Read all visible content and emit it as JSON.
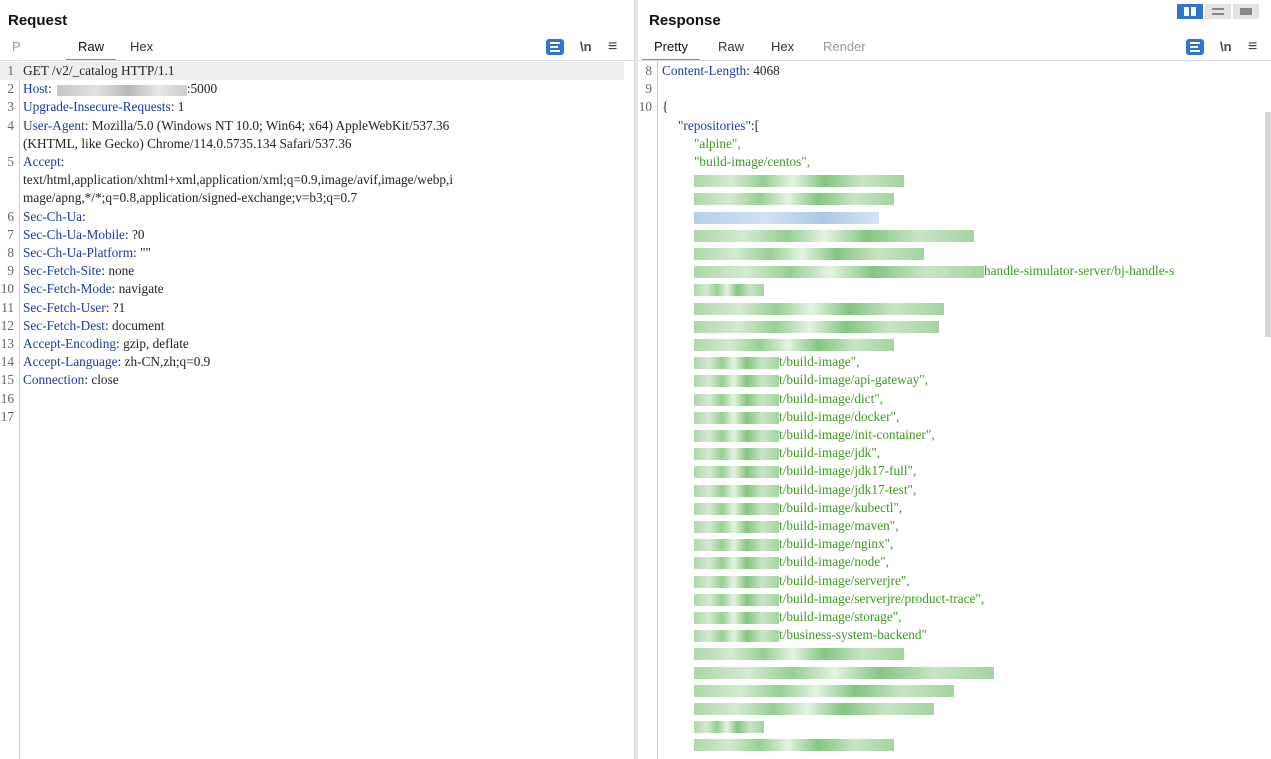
{
  "request": {
    "title": "Request",
    "tabs": [
      {
        "label": "P",
        "state": "dim"
      },
      {
        "label": "Raw",
        "state": "active"
      },
      {
        "label": "Hex",
        "state": "normal"
      }
    ],
    "newline_label": "\\n",
    "menu_label": "≡",
    "lines": [
      {
        "n": "1",
        "text": "GET /v2/_catalog HTTP/1.1"
      },
      {
        "n": "2",
        "key": "Host",
        "value": ":5000"
      },
      {
        "n": "3",
        "key": "Upgrade-Insecure-Requests",
        "value": " 1"
      },
      {
        "n": "4",
        "key": "User-Agent",
        "value": " Mozilla/5.0 (Windows NT 10.0; Win64; x64) AppleWebKit/537.36"
      },
      {
        "n": "",
        "text": "(KHTML, like Gecko) Chrome/114.0.5735.134 Safari/537.36"
      },
      {
        "n": "5",
        "key": "Accept",
        "value": ""
      },
      {
        "n": "",
        "text": "text/html,application/xhtml+xml,application/xml;q=0.9,image/avif,image/webp,i"
      },
      {
        "n": "",
        "text": "mage/apng,*/*;q=0.8,application/signed-exchange;v=b3;q=0.7"
      },
      {
        "n": "6",
        "key": "Sec-Ch-Ua",
        "value": ""
      },
      {
        "n": "7",
        "key": "Sec-Ch-Ua-Mobile",
        "value": " ?0"
      },
      {
        "n": "8",
        "key": "Sec-Ch-Ua-Platform",
        "value": " \"\""
      },
      {
        "n": "9",
        "key": "Sec-Fetch-Site",
        "value": " none"
      },
      {
        "n": "10",
        "key": "Sec-Fetch-Mode",
        "value": " navigate"
      },
      {
        "n": "11",
        "key": "Sec-Fetch-User",
        "value": " ?1"
      },
      {
        "n": "12",
        "key": "Sec-Fetch-Dest",
        "value": " document"
      },
      {
        "n": "13",
        "key": "Accept-Encoding",
        "value": " gzip, deflate"
      },
      {
        "n": "14",
        "key": "Accept-Language",
        "value": " zh-CN,zh;q=0.9"
      },
      {
        "n": "15",
        "key": "Connection",
        "value": " close"
      },
      {
        "n": "16",
        "text": ""
      },
      {
        "n": "17",
        "text": ""
      }
    ]
  },
  "response": {
    "title": "Response",
    "tabs": [
      {
        "label": "Pretty",
        "state": "active"
      },
      {
        "label": "Raw",
        "state": "normal"
      },
      {
        "label": "Hex",
        "state": "normal"
      },
      {
        "label": "Render",
        "state": "dim"
      }
    ],
    "newline_label": "\\n",
    "menu_label": "≡",
    "lines": [
      {
        "n": "8",
        "key": "Content-Length",
        "value": " 4068"
      },
      {
        "n": "9",
        "text": ""
      },
      {
        "n": "10",
        "text": "{"
      },
      {
        "n": "",
        "jkey": "\"repositories\"",
        "tail": ":["
      },
      {
        "n": "",
        "jstr": "\"alpine\","
      },
      {
        "n": "",
        "jstr": "\"build-image/centos\","
      },
      {
        "n": "",
        "blur": 1
      },
      {
        "n": "",
        "blur": 1
      },
      {
        "n": "",
        "blur": 1,
        "sel": true
      },
      {
        "n": "",
        "blur": 1
      },
      {
        "n": "",
        "blur": 1
      },
      {
        "n": "",
        "jstr": "handle-simulator-server/bj-handle-s",
        "pre": 1
      },
      {
        "n": "",
        "blur": 1,
        "short": true
      },
      {
        "n": "",
        "blur": 1
      },
      {
        "n": "",
        "blur": 1
      },
      {
        "n": "",
        "blur": 1
      },
      {
        "n": "",
        "jstr": "t/build-image\",",
        "pre": 1
      },
      {
        "n": "",
        "jstr": "t/build-image/api-gateway\",",
        "pre": 1
      },
      {
        "n": "",
        "jstr": "t/build-image/dict\",",
        "pre": 1
      },
      {
        "n": "",
        "jstr": "t/build-image/docker\",",
        "pre": 1
      },
      {
        "n": "",
        "jstr": "t/build-image/init-container\",",
        "pre": 1
      },
      {
        "n": "",
        "jstr": "t/build-image/jdk\",",
        "pre": 1
      },
      {
        "n": "",
        "jstr": "t/build-image/jdk17-full\",",
        "pre": 1
      },
      {
        "n": "",
        "jstr": "t/build-image/jdk17-test\",",
        "pre": 1
      },
      {
        "n": "",
        "jstr": "t/build-image/kubectl\",",
        "pre": 1
      },
      {
        "n": "",
        "jstr": "t/build-image/maven\",",
        "pre": 1
      },
      {
        "n": "",
        "jstr": "t/build-image/nginx\",",
        "pre": 1
      },
      {
        "n": "",
        "jstr": "t/build-image/node\",",
        "pre": 1
      },
      {
        "n": "",
        "jstr": "t/build-image/serverjre\",",
        "pre": 1
      },
      {
        "n": "",
        "jstr": "t/build-image/serverjre/product-trace\",",
        "pre": 1
      },
      {
        "n": "",
        "jstr": "t/build-image/storage\",",
        "pre": 1
      },
      {
        "n": "",
        "jstr": "t/business-system-backend\"",
        "pre": 1
      },
      {
        "n": "",
        "blur": 1
      },
      {
        "n": "",
        "blur": 1
      },
      {
        "n": "",
        "blur": 1
      },
      {
        "n": "",
        "blur": 1
      },
      {
        "n": "",
        "blur": 1,
        "short": true
      },
      {
        "n": "",
        "blur": 1
      }
    ]
  }
}
